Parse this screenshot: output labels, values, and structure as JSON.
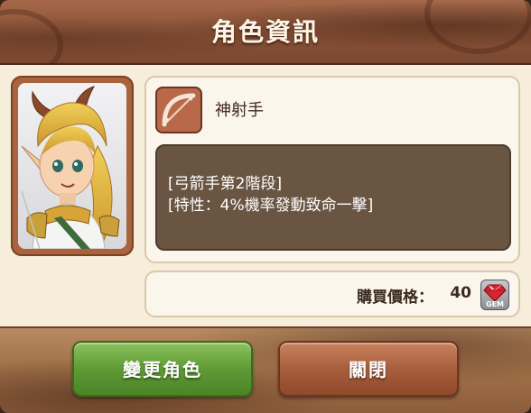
{
  "dialog": {
    "title": "角色資訊"
  },
  "character": {
    "class_name": "神射手",
    "class_icon": "bow-icon",
    "description_lines": [
      "[弓箭手第2階段]",
      "[特性：4%機率發動致命一擊]"
    ],
    "portrait": "elf-archer-portrait"
  },
  "price": {
    "label": "購買價格：",
    "value": "40",
    "currency_icon": "gem-icon",
    "currency_label": "GEM"
  },
  "buttons": {
    "change_label": "變更角色",
    "close_label": "關閉"
  },
  "colors": {
    "header": "#8a5236",
    "panel": "#fbf6ec",
    "desc_box": "#6a5543",
    "change_button": "#5f9a34",
    "close_button": "#a85e3c"
  }
}
